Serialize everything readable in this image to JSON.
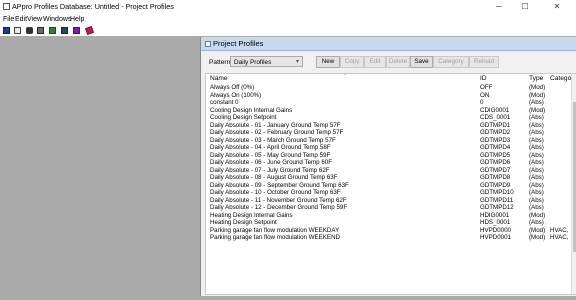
{
  "window": {
    "title": "APpro Profiles Database: Untitled - Project Profiles",
    "minimize_glyph": "─",
    "maximize_glyph": "☐",
    "close_glyph": "✕"
  },
  "menu": [
    "File",
    "Edit",
    "View",
    "Windows",
    "Help"
  ],
  "toolbar": {
    "icons": [
      "save-icon",
      "print-icon",
      "find-icon",
      "copy-icon",
      "database-icon",
      "grid-icon",
      "book-icon",
      "eraser-icon"
    ]
  },
  "panel": {
    "title": "Project Profiles",
    "pattern_label": "Pattern:",
    "pattern_value": "Daily Profiles",
    "pattern_arrow": "▾",
    "buttons": [
      {
        "label": "New",
        "enabled": true
      },
      {
        "label": "Copy",
        "enabled": false
      },
      {
        "label": "Edit",
        "enabled": false
      },
      {
        "label": "Delete",
        "enabled": false
      },
      {
        "label": "Save",
        "enabled": true
      },
      {
        "label": "Category",
        "enabled": false
      },
      {
        "label": "Reload",
        "enabled": false
      }
    ]
  },
  "table": {
    "columns": {
      "name": "Name",
      "id": "ID",
      "type": "Type",
      "category": "Categor"
    },
    "sort_glyph": "^",
    "rows": [
      {
        "name": "Always Off (0%)",
        "id": "OFF",
        "type": "(Mod)",
        "category": ""
      },
      {
        "name": "Always On (100%)",
        "id": "ON",
        "type": "(Mod)",
        "category": ""
      },
      {
        "name": "constant 0",
        "id": "0",
        "type": "(Abs)",
        "category": ""
      },
      {
        "name": "Cooling Design Internal Gains",
        "id": "CDIG0001",
        "type": "(Mod)",
        "category": ""
      },
      {
        "name": "Cooling Design Setpoint",
        "id": "CDS_0001",
        "type": "(Abs)",
        "category": ""
      },
      {
        "name": "Daily Absolute - 01 - January Ground Temp 57F",
        "id": "GDTMPD1",
        "type": "(Abs)",
        "category": ""
      },
      {
        "name": "Daily Absolute - 02 - February Ground Temp 57F",
        "id": "GDTMPD2",
        "type": "(Abs)",
        "category": ""
      },
      {
        "name": "Daily Absolute - 03 - March Ground Temp 57F",
        "id": "GDTMPD3",
        "type": "(Abs)",
        "category": ""
      },
      {
        "name": "Daily Absolute - 04 - April Ground Temp 58F",
        "id": "GDTMPD4",
        "type": "(Abs)",
        "category": ""
      },
      {
        "name": "Daily Absolute - 05 - May Ground Temp 59F",
        "id": "GDTMPD5",
        "type": "(Abs)",
        "category": ""
      },
      {
        "name": "Daily Absolute - 06 - June Ground Temp 60F",
        "id": "GDTMPD6",
        "type": "(Abs)",
        "category": ""
      },
      {
        "name": "Daily Absolute - 07 - July Ground Temp 62F",
        "id": "GDTMPD7",
        "type": "(Abs)",
        "category": ""
      },
      {
        "name": "Daily Absolute - 08 - August Ground Temp 63F",
        "id": "GDTMPD8",
        "type": "(Abs)",
        "category": ""
      },
      {
        "name": "Daily Absolute - 09 - September Ground Temp 63F",
        "id": "GDTMPD9",
        "type": "(Abs)",
        "category": ""
      },
      {
        "name": "Daily Absolute - 10 - October Ground Temp 63F",
        "id": "GDTMPD10",
        "type": "(Abs)",
        "category": ""
      },
      {
        "name": "Daily Absolute - 11 - November Ground Temp 62F",
        "id": "GDTMPD11",
        "type": "(Abs)",
        "category": ""
      },
      {
        "name": "Daily Absolute - 12 - December Ground Temp 59F",
        "id": "GDTMPD12",
        "type": "(Abs)",
        "category": ""
      },
      {
        "name": "Heating Design Internal Gains",
        "id": "HDIG0001",
        "type": "(Mod)",
        "category": ""
      },
      {
        "name": "Heating Design Setpoint",
        "id": "HDS_0001",
        "type": "(Abs)",
        "category": ""
      },
      {
        "name": "Parking garage fan flow modulation WEEKDAY",
        "id": "HVPD0000",
        "type": "(Mod)",
        "category": "HVAC,"
      },
      {
        "name": "Parking garage fan flow modulation WEEKEND",
        "id": "HVPD0001",
        "type": "(Mod)",
        "category": "HVAC,"
      }
    ]
  },
  "colors": {
    "mdi_background": "#ababab",
    "panel_title_bar": "#c6d9ef",
    "disabled_text": "#a0a0a0"
  }
}
